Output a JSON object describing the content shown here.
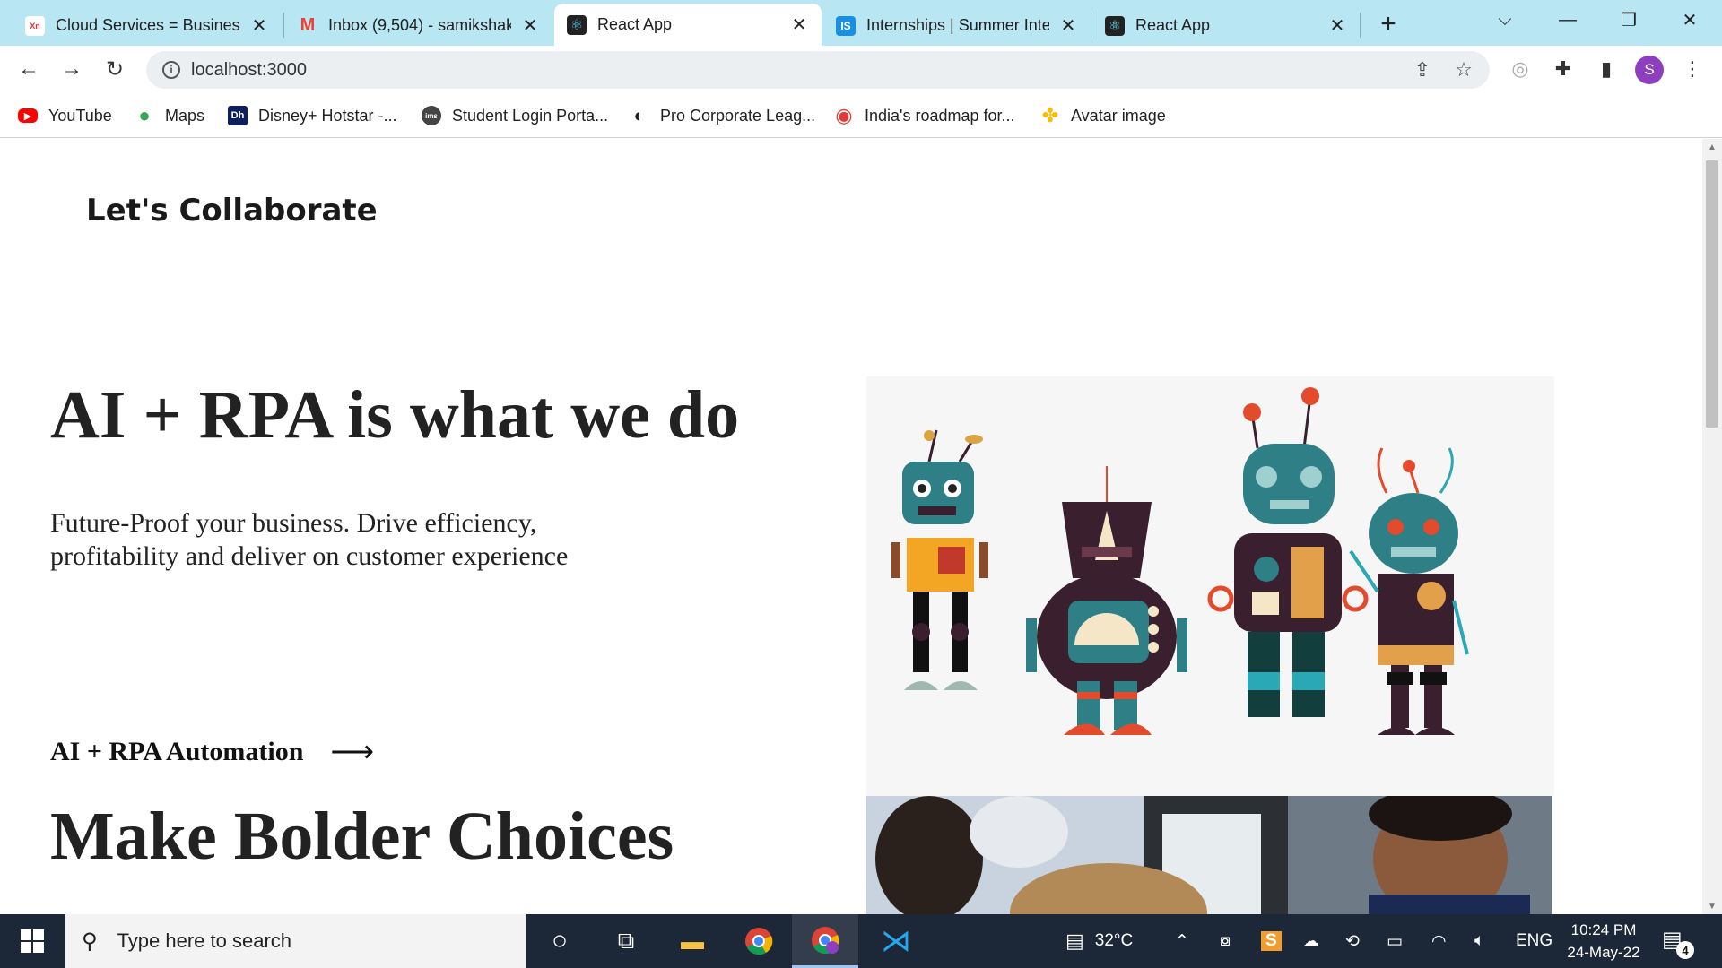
{
  "browser": {
    "tabs": [
      {
        "title": "Cloud Services = Business",
        "favicon_text": "Xn",
        "favicon_color": "#ffffff",
        "active": false
      },
      {
        "title": "Inbox (9,504) - samikshak",
        "favicon_text": "M",
        "favicon_color": "#ea4335",
        "active": false
      },
      {
        "title": "React App",
        "favicon_text": "⚛",
        "favicon_color": "#222222",
        "active": true
      },
      {
        "title": "Internships | Summer Inte",
        "favicon_text": "IS",
        "favicon_color": "#1a8fe0",
        "active": false
      },
      {
        "title": "React App",
        "favicon_text": "⚛",
        "favicon_color": "#222222",
        "active": false
      }
    ],
    "new_tab_label": "+",
    "address": "localhost:3000",
    "profile_initial": "S",
    "bookmarks": [
      {
        "label": "YouTube",
        "icon": "youtube-icon",
        "color": "#ff0000"
      },
      {
        "label": "Maps",
        "icon": "maps-icon",
        "color": "#34a853"
      },
      {
        "label": "Disney+ Hotstar -...",
        "icon": "hotstar-icon",
        "color": "#0f1f5c"
      },
      {
        "label": "Student Login Porta...",
        "icon": "portal-icon",
        "color": "#444444"
      },
      {
        "label": "Pro Corporate Leag...",
        "icon": "globe-icon",
        "color": "#222222"
      },
      {
        "label": "India's roadmap for...",
        "icon": "roadmap-icon",
        "color": "#e53935"
      },
      {
        "label": "Avatar image",
        "icon": "pinwheel-icon",
        "color": "#fbbc05"
      }
    ]
  },
  "page": {
    "brand": "Let's Collaborate",
    "hero_title": "AI + RPA is what we do",
    "hero_subtitle": "Future-Proof your business. Drive efficiency, profitability and deliver on customer experience",
    "service_link": "AI + RPA Automation",
    "service_arrow": "⟶",
    "section_title": "Make Bolder Choices"
  },
  "taskbar": {
    "search_placeholder": "Type here to search",
    "weather": "32°C",
    "language": "ENG",
    "time": "10:24 PM",
    "date": "24-May-22",
    "notification_count": "4"
  },
  "colors": {
    "tabstrip": "#b8e6f2",
    "taskbar": "#1c2837",
    "robot_teal": "#2f7f86",
    "robot_orange": "#f2a623",
    "robot_red": "#e24b2b",
    "robot_dark": "#3a1f2e"
  }
}
